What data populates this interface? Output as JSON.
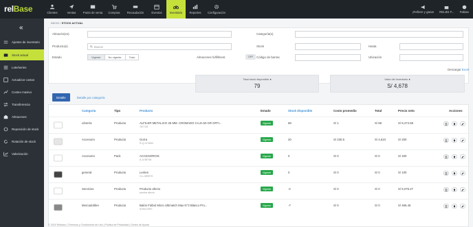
{
  "app": {
    "logo_prefix": "rel",
    "logo_suffix": "Base"
  },
  "nav": [
    {
      "label": "Clientes",
      "icon": "users-icon"
    },
    {
      "label": "Ventas",
      "icon": "send-icon"
    },
    {
      "label": "Punto de venta",
      "icon": "pos-icon"
    },
    {
      "label": "Compras",
      "icon": "cart-icon"
    },
    {
      "label": "Recaudación",
      "icon": "money-icon"
    },
    {
      "label": "Eventos",
      "icon": "calendar-icon"
    },
    {
      "label": "Inventario",
      "icon": "bicycle-icon"
    },
    {
      "label": "Reportes",
      "icon": "chart-icon"
    },
    {
      "label": "Configuración",
      "icon": "gear-icon"
    }
  ],
  "top_right": {
    "refer": "¡Refiere y gana!",
    "store": "RELBS F...",
    "user": "Fabian"
  },
  "sidebar": {
    "collapse_icon": "«",
    "items": [
      {
        "label": "Ajustes de inventario",
        "icon": "adjust-icon"
      },
      {
        "label": "Stock actual",
        "icon": "stock-icon"
      },
      {
        "label": "Lote/series",
        "icon": "lot-icon"
      },
      {
        "label": "Actualizar costos",
        "icon": "cost-update-icon"
      },
      {
        "label": "Costeo masivo",
        "icon": "bulk-cost-icon"
      },
      {
        "label": "Transferencia",
        "icon": "transfer-icon"
      },
      {
        "label": "Almacenes",
        "icon": "warehouse-icon"
      },
      {
        "label": "Reposición de stock",
        "icon": "restock-icon"
      },
      {
        "label": "Rotación de stock",
        "icon": "rotation-icon"
      },
      {
        "label": "Valorización",
        "icon": "valuation-icon"
      }
    ]
  },
  "breadcrumb": {
    "home": "INICIO",
    "current": "STOCK ACTUAL"
  },
  "filters": {
    "almacen": {
      "label": "Almacén(es)"
    },
    "productos": {
      "label": "Producto(s)",
      "placeholder": "Buscar"
    },
    "estado": {
      "label": "Estado",
      "options": [
        "Vigente",
        "No vigente",
        "Todo"
      ],
      "selected": "Vigente"
    },
    "fulfillment": {
      "label": "Almacenes fulfillment",
      "toggle": "OFF"
    },
    "categorias": {
      "label": "Categoría(s)"
    },
    "stock": {
      "label": "Stock"
    },
    "hasta": {
      "label": "Hasta"
    },
    "barras": {
      "label": "Código de barras"
    },
    "ubicacion": {
      "label": "Ubicación"
    }
  },
  "download": {
    "text": "Descargar",
    "link": "Excel"
  },
  "kpis": {
    "stock_title": "Total stock disponible",
    "stock_value": "79",
    "value_title": "Valor del inventario",
    "value_value": "S/ 4,678"
  },
  "tabs": {
    "detalle": "Detalle",
    "categoria": "Detalle por categoría"
  },
  "table": {
    "headers": {
      "categoria": "Categoría",
      "tipo": "Tipo",
      "producto": "Producto",
      "estado": "Estado",
      "stock": "Stock disponible",
      "costo": "Costo promedio",
      "total": "Total",
      "precio": "Precio neto",
      "acciones": "Acciones"
    },
    "rows": [
      {
        "categoria": "Librería",
        "tipo": "Producto",
        "producto": "ALFILER METALICO 25 MM. CROMADO CAJA 50 GR OFFI...",
        "sku": "787728",
        "estado": "Vigente",
        "stock": "68",
        "costo": "S/ 1",
        "total": "S/ 68",
        "precio": "S/ 8,474.58"
      },
      {
        "categoria": "Accesorio",
        "tipo": "Producto",
        "producto": "Gorra",
        "sku": "R-Q-374553",
        "estado": "Vigente",
        "stock": "20",
        "costo": "S/ 230.5",
        "total": "S/ 4,610",
        "precio": "S/ 200"
      },
      {
        "categoria": "Accesorio",
        "tipo": "Pack",
        "producto": "ACCESORIOS",
        "sku": "A-A-98748",
        "estado": "Vigente",
        "stock": "0",
        "costo": "S/ 0",
        "total": "S/ 0",
        "precio": "S/ 400"
      },
      {
        "categoria": "general",
        "tipo": "Producto",
        "producto": "Lentes",
        "sku": "G-L-559979",
        "estado": "Vigente",
        "stock": "0",
        "costo": "S/ 0",
        "total": "S/ 0",
        "precio": "S/ 100"
      },
      {
        "categoria": "Servicios",
        "tipo": "Producto",
        "producto": "Producto afecto",
        "sku": "prueba afecto",
        "estado": "Vigente",
        "stock": "-2",
        "costo": "S/ 0",
        "total": "S/ 0",
        "precio": "S/ 5,076.27"
      },
      {
        "categoria": "Mercadolibre",
        "tipo": "Producto",
        "producto": "Balón Fútbol Micro Ultimatch Max N°3 Blanco Pro...",
        "sku": "8750214P0",
        "estado": "Vigente",
        "stock": "-7",
        "costo": "S/ 0",
        "total": "S/ 0",
        "precio": "S/ 466.45"
      }
    ]
  },
  "footer": "© 2024 Relbase | Términos y Condiciones de Uso | Política de Privacidad | Centro de Ayuda",
  "colors": {
    "accent": "#c6e03b",
    "topbar": "#1f2429",
    "sidebar": "#2b3137",
    "badge": "#27a84a",
    "link": "#3b8dd4",
    "tab": "#3267b0"
  }
}
